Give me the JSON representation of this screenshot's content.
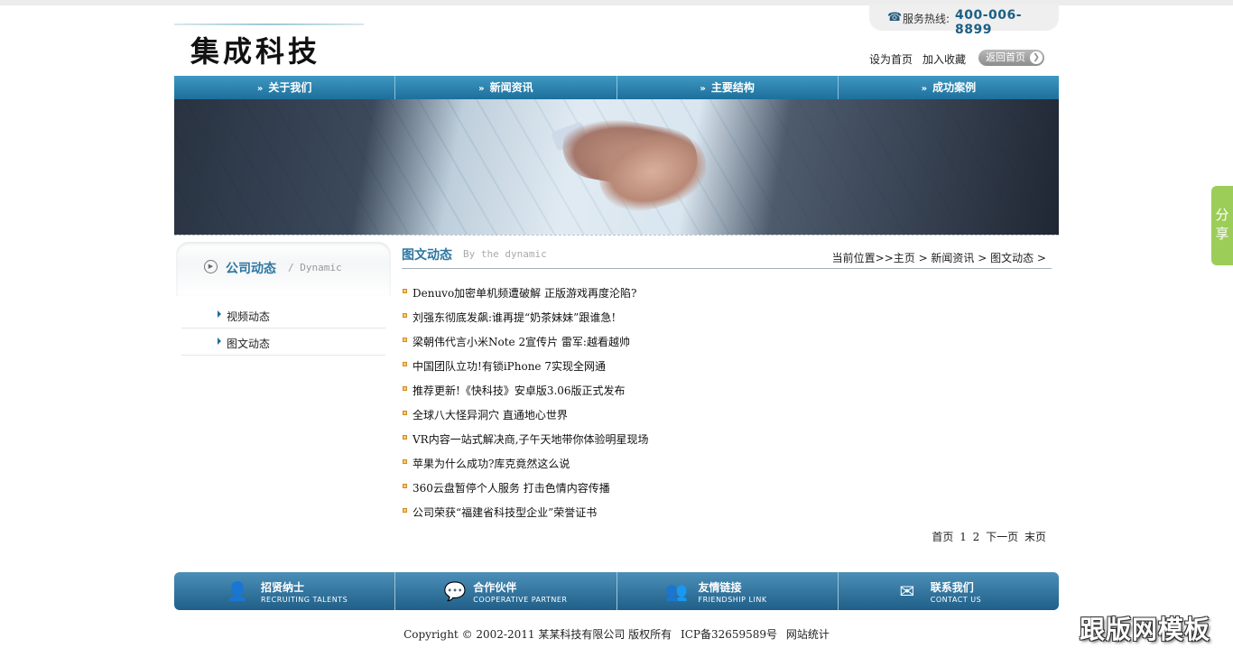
{
  "header": {
    "logo_text": "集成科技",
    "hotline_label": "服务热线:",
    "hotline_number": "400-006-8899",
    "set_home": "设为首页",
    "add_favorite": "加入收藏",
    "back_home": "返回首页"
  },
  "nav": [
    {
      "label": "关于我们"
    },
    {
      "label": "新闻资讯"
    },
    {
      "label": "主要结构"
    },
    {
      "label": "成功案例"
    }
  ],
  "sidebar": {
    "title": "公司动态",
    "subtitle": "/ Dynamic",
    "items": [
      {
        "label": "视频动态"
      },
      {
        "label": "图文动态"
      }
    ]
  },
  "main": {
    "title": "图文动态",
    "subtitle": "By the dynamic",
    "breadcrumb": "当前位置>>主页 > 新闻资讯 > 图文动态 >",
    "news": [
      {
        "title": "Denuvo加密单机频遭破解 正版游戏再度沦陷?"
      },
      {
        "title": "刘强东彻底发飙:谁再提“奶茶妹妹”跟谁急!"
      },
      {
        "title": "梁朝伟代言小米Note 2宣传片 雷军:越看越帅"
      },
      {
        "title": "中国团队立功!有锁iPhone 7实现全网通"
      },
      {
        "title": "推荐更新!《快科技》安卓版3.06版正式发布"
      },
      {
        "title": "全球八大怪异洞穴 直通地心世界"
      },
      {
        "title": "VR内容一站式解决商,子午天地带你体验明星现场"
      },
      {
        "title": "苹果为什么成功?库克竟然这么说"
      },
      {
        "title": "360云盘暂停个人服务 打击色情内容传播"
      },
      {
        "title": "公司荣获“福建省科技型企业”荣誉证书"
      }
    ],
    "pager": {
      "first": "首页",
      "page1": "1",
      "page2": "2",
      "next": "下一页",
      "last": "末页"
    }
  },
  "footer_bar": [
    {
      "title": "招贤纳士",
      "en": "RECRUITING TALENTS",
      "icon": "user-icon"
    },
    {
      "title": "合作伙伴",
      "en": "COOPERATIVE PARTNER",
      "icon": "chat-icon"
    },
    {
      "title": "友情链接",
      "en": "FRIENDSHIP LINK",
      "icon": "group-icon"
    },
    {
      "title": "联系我们",
      "en": "CONTACT US",
      "icon": "mail-icon"
    }
  ],
  "copyright": {
    "text": "Copyright © 2002-2011 某某科技有限公司 版权所有",
    "icp": "ICP备32659589号",
    "stats": "网站统计"
  },
  "share": {
    "label": "分享"
  },
  "watermark": "跟版网模板",
  "colors": {
    "brand_blue": "#1d6f9b",
    "title_blue": "#2d76a1",
    "share_green": "#9ccd58"
  }
}
